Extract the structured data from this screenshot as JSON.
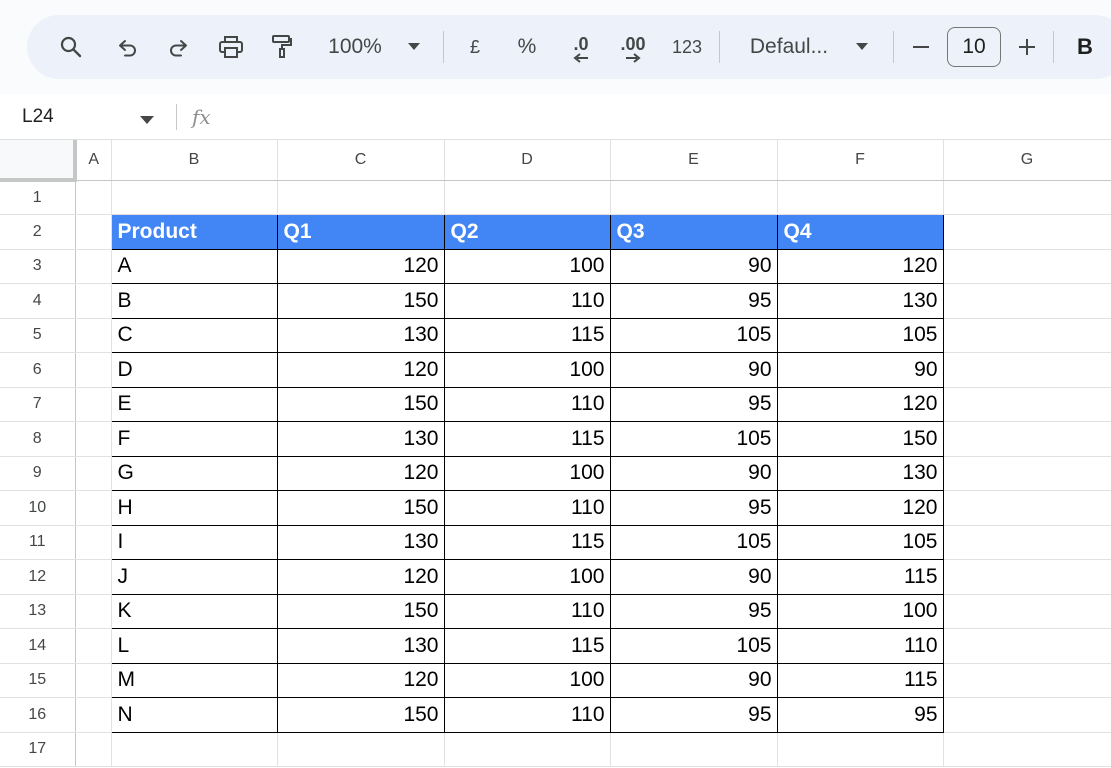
{
  "toolbar": {
    "zoom": "100%",
    "currency": "£",
    "percent": "%",
    "decrease_decimal": ".0",
    "increase_decimal": ".00",
    "number_format": "123",
    "font": "Defaul...",
    "font_size": "10",
    "bold": "B"
  },
  "formula_bar": {
    "cell_ref": "L24",
    "fx": "fx"
  },
  "columns": [
    "A",
    "B",
    "C",
    "D",
    "E",
    "F",
    "G"
  ],
  "row_numbers": [
    "1",
    "2",
    "3",
    "4",
    "5",
    "6",
    "7",
    "8",
    "9",
    "10",
    "11",
    "12",
    "13",
    "14",
    "15",
    "16",
    "17"
  ],
  "table": {
    "headers": [
      "Product",
      "Q1",
      "Q2",
      "Q3",
      "Q4"
    ],
    "header_color": "#4285f4",
    "rows": [
      [
        "A",
        "120",
        "100",
        "90",
        "120"
      ],
      [
        "B",
        "150",
        "110",
        "95",
        "130"
      ],
      [
        "C",
        "130",
        "115",
        "105",
        "105"
      ],
      [
        "D",
        "120",
        "100",
        "90",
        "90"
      ],
      [
        "E",
        "150",
        "110",
        "95",
        "120"
      ],
      [
        "F",
        "130",
        "115",
        "105",
        "150"
      ],
      [
        "G",
        "120",
        "100",
        "90",
        "130"
      ],
      [
        "H",
        "150",
        "110",
        "95",
        "120"
      ],
      [
        "I",
        "130",
        "115",
        "105",
        "105"
      ],
      [
        "J",
        "120",
        "100",
        "90",
        "115"
      ],
      [
        "K",
        "150",
        "110",
        "95",
        "100"
      ],
      [
        "L",
        "130",
        "115",
        "105",
        "110"
      ],
      [
        "M",
        "120",
        "100",
        "90",
        "115"
      ],
      [
        "N",
        "150",
        "110",
        "95",
        "95"
      ]
    ]
  }
}
